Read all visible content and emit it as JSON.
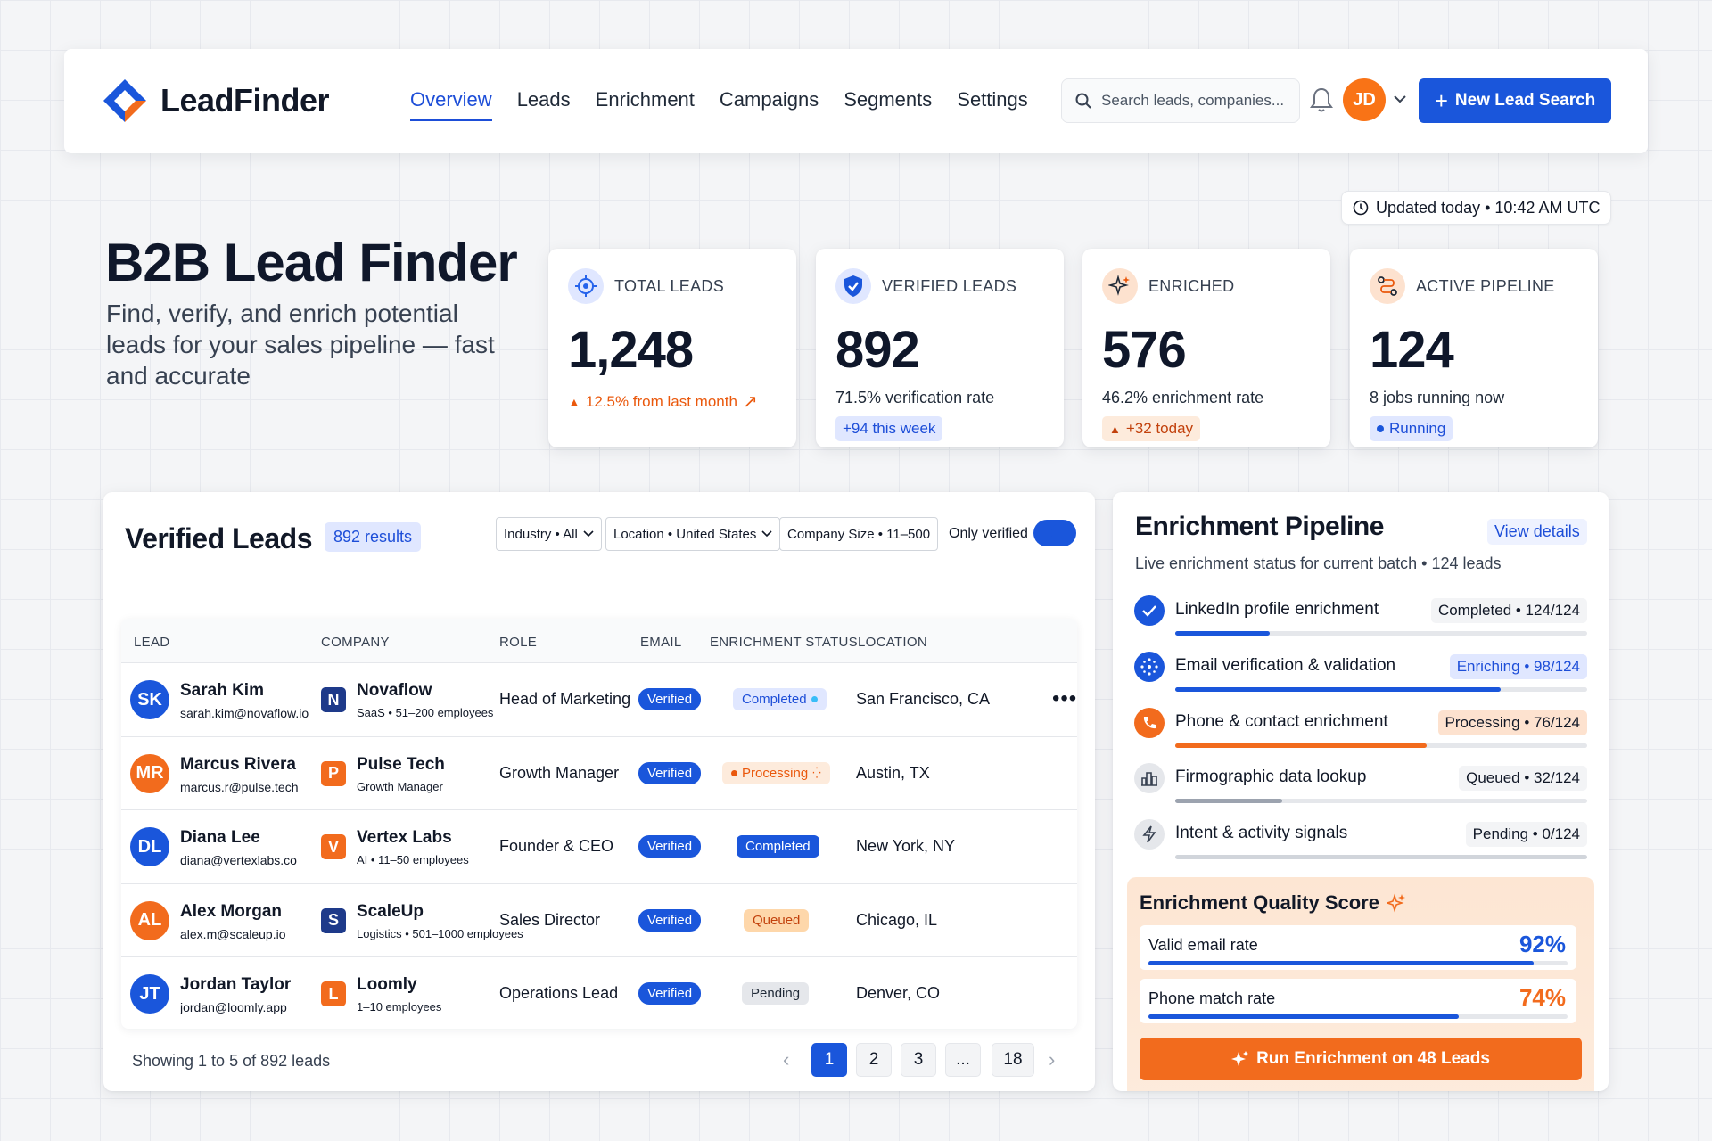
{
  "brand": {
    "name": "LeadFinder"
  },
  "nav": {
    "links": [
      "Overview",
      "Leads",
      "Enrichment",
      "Campaigns",
      "Segments",
      "Settings"
    ],
    "active": "Overview",
    "search_placeholder": "Search leads, companies...",
    "user_initials": "JD",
    "new_button": "New Lead Search"
  },
  "hero": {
    "title": "B2B Lead Finder",
    "subtitle": "Find, verify, and enrich potential leads for your sales pipeline — fast and accurate",
    "updated": "Updated today • 10:42 AM UTC"
  },
  "stats": [
    {
      "label": "TOTAL LEADS",
      "value": "1,248",
      "sub": "",
      "chip": "12.5% from last month",
      "icon": "target-icon",
      "accent": "#2563eb"
    },
    {
      "label": "VERIFIED LEADS",
      "value": "892",
      "sub": "71.5% verification rate",
      "chip": "+94 this week",
      "icon": "shield-check-icon",
      "accent": "#2563eb"
    },
    {
      "label": "ENRICHED",
      "value": "576",
      "sub": "46.2% enrichment rate",
      "chip": "+32 today",
      "icon": "sparkle-icon",
      "accent": "#ea580c"
    },
    {
      "label": "ACTIVE PIPELINE",
      "value": "124",
      "sub": "8 jobs running now",
      "chip": "Running",
      "icon": "route-icon",
      "accent": "#ea580c"
    }
  ],
  "leads": {
    "title": "Verified Leads",
    "results": "892 results",
    "filters": [
      "Industry • All",
      "Location • United States",
      "Company Size • 11–500"
    ],
    "only_verified": "Only verified",
    "columns": [
      "LEAD",
      "COMPANY",
      "ROLE",
      "EMAIL",
      "ENRICHMENT STATUS",
      "LOCATION"
    ],
    "rows": [
      {
        "initials": "SK",
        "name": "Sarah Kim",
        "email": "sarah.kim@novaflow.io",
        "company": "Novaflow",
        "company_initial": "N",
        "company_meta": "SaaS • 51–200 employees",
        "role": "Head of Marketing",
        "email_status": "Verified",
        "status": "Completed",
        "location": "San Francisco, CA",
        "avatar_color": "#1a56db",
        "logo_color": "#1e3a8a"
      },
      {
        "initials": "MR",
        "name": "Marcus Rivera",
        "email": "marcus.r@pulse.tech",
        "company": "Pulse Tech",
        "company_initial": "P",
        "company_meta": "Growth Manager",
        "role": "Growth Manager",
        "email_status": "Verified",
        "status": "Processing",
        "location": "Austin, TX",
        "avatar_color": "#f26b1d",
        "logo_color": "#f26b1d"
      },
      {
        "initials": "DL",
        "name": "Diana Lee",
        "email": "diana@vertexlabs.co",
        "company": "Vertex Labs",
        "company_initial": "V",
        "company_meta": "AI • 11–50 employees",
        "role": "Founder & CEO",
        "email_status": "Verified",
        "status": "Completed",
        "location": "New York, NY",
        "avatar_color": "#1a56db",
        "logo_color": "#f26b1d"
      },
      {
        "initials": "AL",
        "name": "Alex Morgan",
        "email": "alex.m@scaleup.io",
        "company": "ScaleUp",
        "company_initial": "S",
        "company_meta": "Logistics • 501–1000 employees",
        "role": "Sales Director",
        "email_status": "Verified",
        "status": "Queued",
        "location": "Chicago, IL",
        "avatar_color": "#f26b1d",
        "logo_color": "#1e3a8a"
      },
      {
        "initials": "JT",
        "name": "Jordan Taylor",
        "email": "jordan@loomly.app",
        "company": "Loomly",
        "company_initial": "L",
        "company_meta": "1–10 employees",
        "role": "Operations Lead",
        "email_status": "Verified",
        "status": "Pending",
        "location": "Denver, CO",
        "avatar_color": "#1a56db",
        "logo_color": "#f26b1d"
      }
    ],
    "showing": "Showing 1 to 5 of 892 leads",
    "pages": [
      "1",
      "2",
      "3",
      "...",
      "18"
    ]
  },
  "pipeline": {
    "title": "Enrichment Pipeline",
    "view_details": "View details",
    "subtitle": "Live enrichment status for current batch • 124 leads",
    "steps": [
      {
        "name": "LinkedIn profile enrichment",
        "badge": "Completed • 124/124",
        "progress": 0.23,
        "icon": "check-icon"
      },
      {
        "name": "Email verification & validation",
        "badge": "Enriching • 98/124",
        "progress": 0.79,
        "icon": "email-spinner-icon"
      },
      {
        "name": "Phone & contact enrichment",
        "badge": "Processing • 76/124",
        "progress": 0.61,
        "icon": "phone-icon"
      },
      {
        "name": "Firmographic data lookup",
        "badge": "Queued • 32/124",
        "progress": 0.26,
        "icon": "building-icon"
      },
      {
        "name": "Intent & activity signals",
        "badge": "Pending • 0/124",
        "progress": 0.0,
        "icon": "lightning-icon"
      }
    ],
    "quality": {
      "title": "Enrichment Quality Score",
      "metrics": [
        {
          "label": "Valid email rate",
          "value": "92%",
          "progress": 0.92
        },
        {
          "label": "Phone match rate",
          "value": "74%",
          "progress": 0.74
        }
      ],
      "run_button": "Run Enrichment on 48 Leads"
    }
  }
}
